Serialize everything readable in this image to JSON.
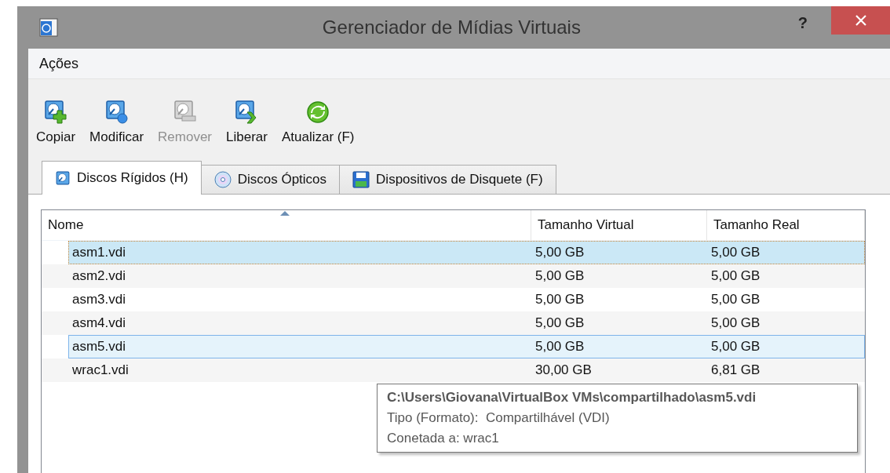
{
  "window": {
    "title": "Gerenciador de Mídias Virtuais",
    "help": "?"
  },
  "menu": [
    {
      "label": "Ações"
    }
  ],
  "toolbar": [
    {
      "label": "Copiar",
      "kind": "copy",
      "disabled": false
    },
    {
      "label": "Modificar",
      "kind": "modify",
      "disabled": false
    },
    {
      "label": "Remover",
      "kind": "remove",
      "disabled": true
    },
    {
      "label": "Liberar",
      "kind": "release",
      "disabled": false
    },
    {
      "label": "Atualizar (F)",
      "kind": "refresh",
      "disabled": false
    }
  ],
  "tabs": [
    {
      "label": "Discos Rígidos (H)",
      "kind": "hdd",
      "selected": true
    },
    {
      "label": "Discos Ópticos",
      "kind": "optical",
      "selected": false
    },
    {
      "label": "Dispositivos de Disquete (F)",
      "kind": "floppy",
      "selected": false
    }
  ],
  "table": {
    "columns": [
      {
        "label": "Nome",
        "sorted": true
      },
      {
        "label": "Tamanho Virtual",
        "sorted": false
      },
      {
        "label": "Tamanho Real",
        "sorted": false
      }
    ],
    "rows": [
      {
        "cells": [
          "asm1.vdi",
          "5,00 GB",
          "5,00 GB"
        ],
        "selected": true,
        "hovered": false
      },
      {
        "cells": [
          "asm2.vdi",
          "5,00 GB",
          "5,00 GB"
        ],
        "selected": false,
        "hovered": false
      },
      {
        "cells": [
          "asm3.vdi",
          "5,00 GB",
          "5,00 GB"
        ],
        "selected": false,
        "hovered": false
      },
      {
        "cells": [
          "asm4.vdi",
          "5,00 GB",
          "5,00 GB"
        ],
        "selected": false,
        "hovered": false
      },
      {
        "cells": [
          "asm5.vdi",
          "5,00 GB",
          "5,00 GB"
        ],
        "selected": false,
        "hovered": true
      },
      {
        "cells": [
          "wrac1.vdi",
          "30,00 GB",
          "6,81 GB"
        ],
        "selected": false,
        "hovered": false
      }
    ]
  },
  "tooltip": {
    "path": "C:\\Users\\Giovana\\VirtualBox VMs\\compartilhado\\asm5.vdi",
    "lines": [
      "Tipo (Formato):  Compartilhável (VDI)",
      "Conetada a: wrac1"
    ]
  }
}
